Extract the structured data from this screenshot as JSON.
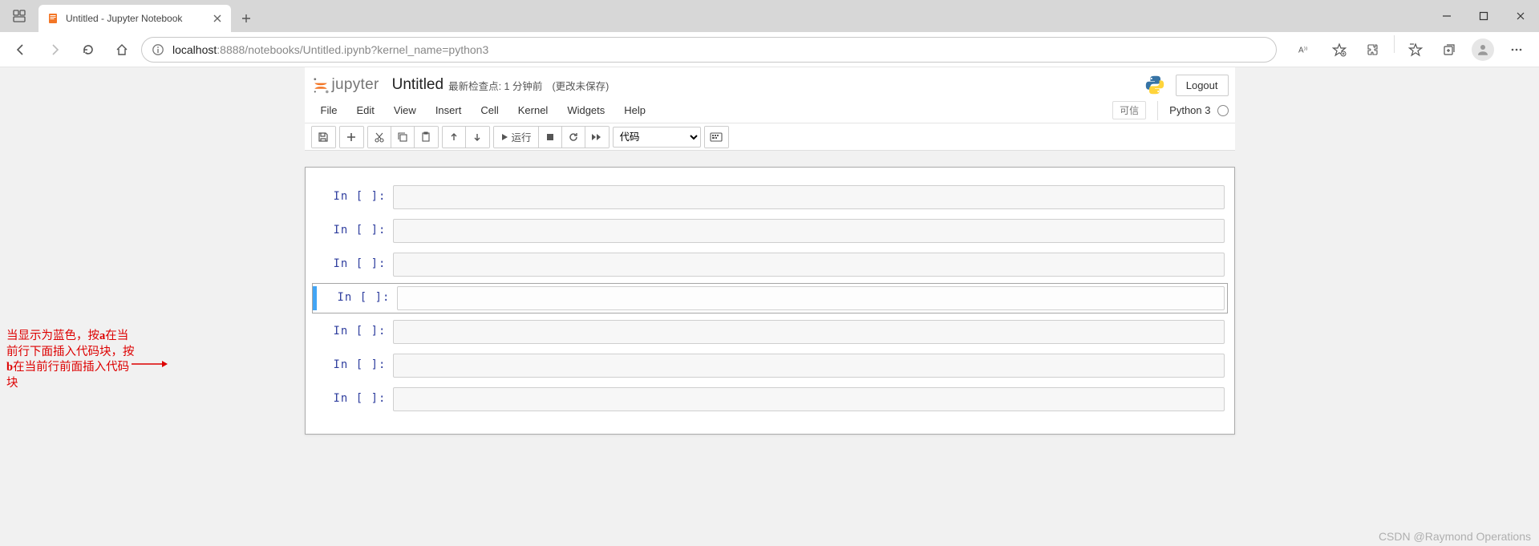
{
  "browser": {
    "tab_title": "Untitled - Jupyter Notebook",
    "url_host": "localhost",
    "url_rest": ":8888/notebooks/Untitled.ipynb?kernel_name=python3"
  },
  "jupyter": {
    "logo_text": "jupyter",
    "title": "Untitled",
    "checkpoint": "最新检查点: 1 分钟前",
    "autosave": "(更改未保存)",
    "logout": "Logout",
    "menu": [
      "File",
      "Edit",
      "View",
      "Insert",
      "Cell",
      "Kernel",
      "Widgets",
      "Help"
    ],
    "trusted": "可信",
    "kernel": "Python 3",
    "run_label": "运行",
    "cell_type": "代码",
    "cells": [
      {
        "prompt": "In [ ]:",
        "selected": false
      },
      {
        "prompt": "In [ ]:",
        "selected": false
      },
      {
        "prompt": "In [ ]:",
        "selected": false
      },
      {
        "prompt": "In [ ]:",
        "selected": true
      },
      {
        "prompt": "In [ ]:",
        "selected": false
      },
      {
        "prompt": "In [ ]:",
        "selected": false
      },
      {
        "prompt": "In [ ]:",
        "selected": false
      }
    ]
  },
  "annotation": {
    "text": "当显示为蓝色，按a在当前行下面插入代码块，按b在当前行前面插入代码块"
  },
  "watermark": "CSDN @Raymond Operations"
}
